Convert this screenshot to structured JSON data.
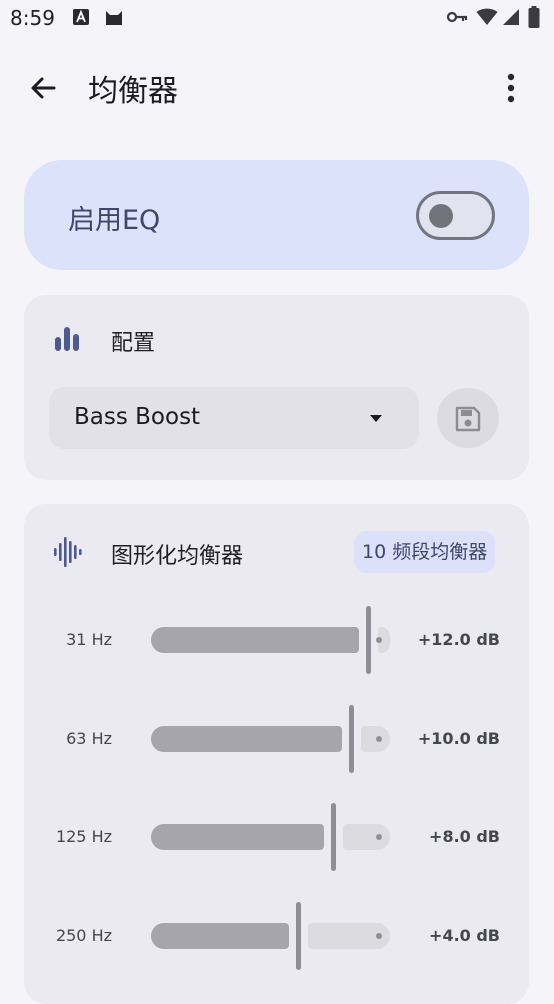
{
  "status_bar": {
    "time": "8:59"
  },
  "top_bar": {
    "title": "均衡器"
  },
  "enable": {
    "label": "启用EQ",
    "enabled": false
  },
  "preset": {
    "title": "配置",
    "selected": "Bass Boost"
  },
  "graphic_eq": {
    "title": "图形化均衡器",
    "badge": "10 频段均衡器",
    "range_db": [
      -12,
      12
    ],
    "bands": [
      {
        "label": "31 Hz",
        "value_text": "+12.0 dB",
        "gain_db": 12.0
      },
      {
        "label": "63 Hz",
        "value_text": "+10.0 dB",
        "gain_db": 10.0
      },
      {
        "label": "125 Hz",
        "value_text": "+8.0 dB",
        "gain_db": 8.0
      },
      {
        "label": "250 Hz",
        "value_text": "+4.0 dB",
        "gain_db": 4.0
      }
    ]
  },
  "colors": {
    "enable_card": "#dde2fb",
    "card": "#ebeaf0",
    "accent": "#3f4767",
    "background": "#f5f4f9"
  }
}
